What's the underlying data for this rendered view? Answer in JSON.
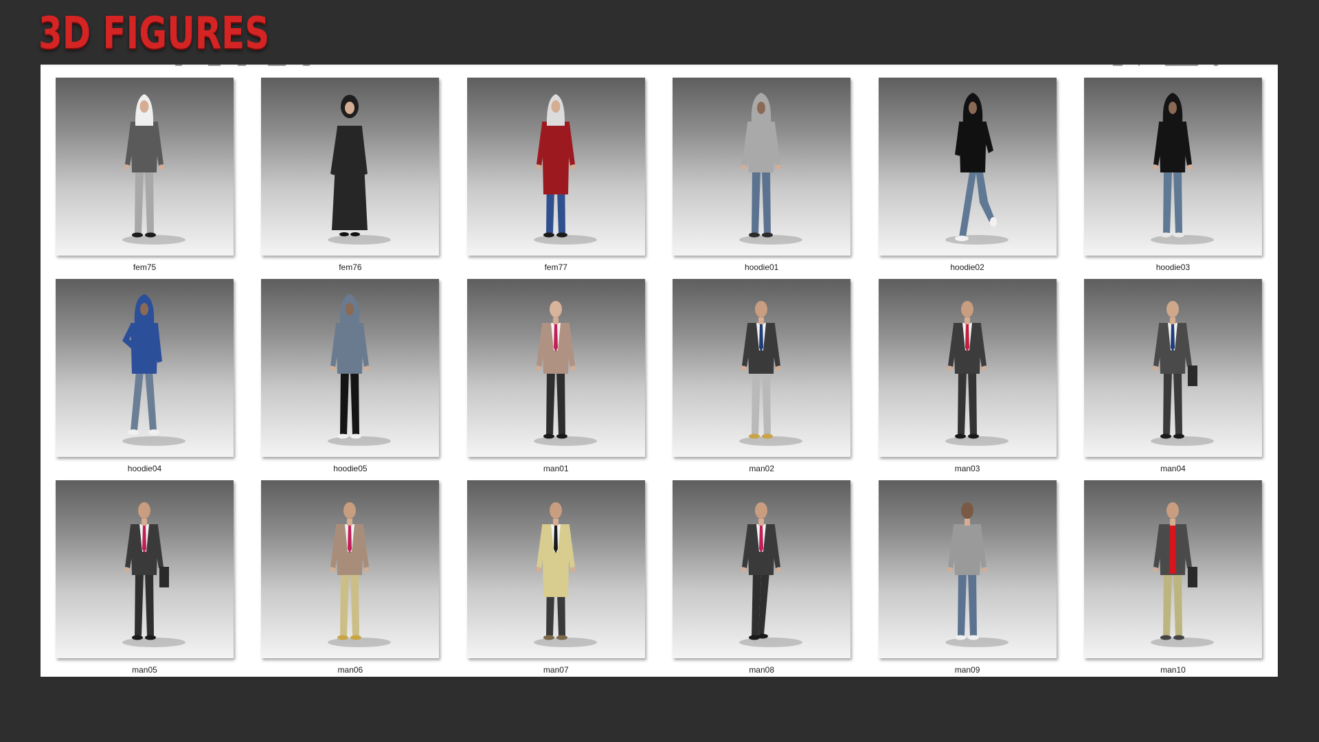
{
  "banner": {
    "title": "3D FIGURES",
    "title_color": "#d42424"
  },
  "tiles": [
    {
      "name": "fem75",
      "fig": {
        "kind": "fem",
        "head": "#e9e9e9",
        "scarf": "#efefef",
        "top": "#5a5a5a",
        "coat": false,
        "legs": "#a8a8a8",
        "shoes": "#1a1a1a",
        "tie": null,
        "bag": false,
        "pose": "standing"
      }
    },
    {
      "name": "fem76",
      "fig": {
        "kind": "robe",
        "head": "#1e1e1e",
        "scarf": "#1e1e1e",
        "top": "#262626",
        "coat": true,
        "legs": "#262626",
        "shoes": "#111111",
        "tie": null,
        "bag": false,
        "pose": "standing"
      }
    },
    {
      "name": "fem77",
      "fig": {
        "kind": "fem",
        "head": "#e4e4e4",
        "scarf": "#dcdcdc",
        "top": "#9c1a1f",
        "coat": true,
        "legs": "#2f4f8f",
        "shoes": "#1a1a1a",
        "tie": null,
        "bag": false,
        "pose": "standing"
      }
    },
    {
      "name": "hoodie01",
      "fig": {
        "kind": "hood",
        "head": "#a9a9a9",
        "scarf": null,
        "top": "#a9a9a9",
        "coat": false,
        "legs": "#5b7390",
        "shoes": "#2a2a2a",
        "tie": null,
        "bag": false,
        "pose": "standing"
      }
    },
    {
      "name": "hoodie02",
      "fig": {
        "kind": "hood",
        "head": "#111111",
        "scarf": null,
        "top": "#111111",
        "coat": false,
        "legs": "#5f7893",
        "shoes": "#f2f2f2",
        "tie": null,
        "bag": false,
        "pose": "leaning"
      }
    },
    {
      "name": "hoodie03",
      "fig": {
        "kind": "hood",
        "head": "#141414",
        "scarf": null,
        "top": "#141414",
        "coat": false,
        "legs": "#5f7893",
        "shoes": "#e8e8e8",
        "tie": null,
        "bag": false,
        "pose": "standing"
      }
    },
    {
      "name": "hoodie04",
      "fig": {
        "kind": "hood",
        "head": "#2c4f9a",
        "scarf": null,
        "top": "#2c4f9a",
        "coat": false,
        "legs": "#6a7f96",
        "shoes": "#f0f0f0",
        "tie": null,
        "bag": false,
        "pose": "watch"
      }
    },
    {
      "name": "hoodie05",
      "fig": {
        "kind": "hood",
        "head": "#6a7b8f",
        "scarf": null,
        "top": "#6a7b8f",
        "coat": false,
        "legs": "#141414",
        "shoes": "#f0f0f0",
        "tie": null,
        "bag": false,
        "pose": "standing"
      }
    },
    {
      "name": "man01",
      "fig": {
        "kind": "suit",
        "head": "#d8b49a",
        "scarf": null,
        "top": "#b09282",
        "coat": false,
        "legs": "#2e2e2e",
        "shoes": "#1a1a1a",
        "tie": "#c21f5a",
        "bag": false,
        "pose": "standing"
      }
    },
    {
      "name": "man02",
      "fig": {
        "kind": "suit",
        "head": "#c99d7f",
        "scarf": null,
        "top": "#3a3a3a",
        "coat": false,
        "legs": "#b9b9b9",
        "shoes": "#c9a446",
        "tie": "#1f3d7a",
        "bag": false,
        "pose": "standing"
      }
    },
    {
      "name": "man03",
      "fig": {
        "kind": "suit",
        "head": "#c99d7f",
        "scarf": null,
        "top": "#3c3c3c",
        "coat": false,
        "legs": "#343434",
        "shoes": "#1a1a1a",
        "tie": "#c21f3f",
        "bag": false,
        "pose": "standing"
      }
    },
    {
      "name": "man04",
      "fig": {
        "kind": "suit",
        "head": "#cfa88c",
        "scarf": null,
        "top": "#4a4a4a",
        "coat": false,
        "legs": "#3a3a3a",
        "shoes": "#1a1a1a",
        "tie": "#1f3d7a",
        "bag": true,
        "pose": "standing"
      }
    },
    {
      "name": "man05",
      "fig": {
        "kind": "suit",
        "head": "#c99d7f",
        "scarf": null,
        "top": "#3a3a3a",
        "coat": false,
        "legs": "#2f2f2f",
        "shoes": "#1a1a1a",
        "tie": "#c21f5a",
        "bag": true,
        "pose": "standing"
      }
    },
    {
      "name": "man06",
      "fig": {
        "kind": "suit",
        "head": "#c99d7f",
        "scarf": null,
        "top": "#a88e7a",
        "coat": false,
        "legs": "#cbbf87",
        "shoes": "#c9a446",
        "tie": "#c21f5a",
        "bag": false,
        "pose": "standing"
      }
    },
    {
      "name": "man07",
      "fig": {
        "kind": "suit",
        "head": "#c99d7f",
        "scarf": null,
        "top": "#d8cc8e",
        "coat": true,
        "legs": "#3a3a3a",
        "shoes": "#7a6a4a",
        "tie": "#1a1a1a",
        "bag": false,
        "pose": "standing"
      }
    },
    {
      "name": "man08",
      "fig": {
        "kind": "suit",
        "head": "#c99d7f",
        "scarf": null,
        "top": "#3a3a3a",
        "coat": false,
        "legs": "#2f2f2f",
        "shoes": "#1a1a1a",
        "tie": "#c21f5a",
        "bag": false,
        "pose": "walking"
      }
    },
    {
      "name": "man09",
      "fig": {
        "kind": "casual",
        "head": "#7a5a44",
        "scarf": null,
        "top": "#9a9a9a",
        "coat": false,
        "legs": "#5b7390",
        "shoes": "#f0f0f0",
        "tie": null,
        "bag": false,
        "pose": "side"
      }
    },
    {
      "name": "man10",
      "fig": {
        "kind": "casual",
        "head": "#c99d7f",
        "scarf": null,
        "top": "#4a4a4a",
        "coat": false,
        "legs": "#bdb580",
        "shoes": "#444444",
        "tie": "#d8141c",
        "bag": true,
        "pose": "standing"
      }
    }
  ]
}
